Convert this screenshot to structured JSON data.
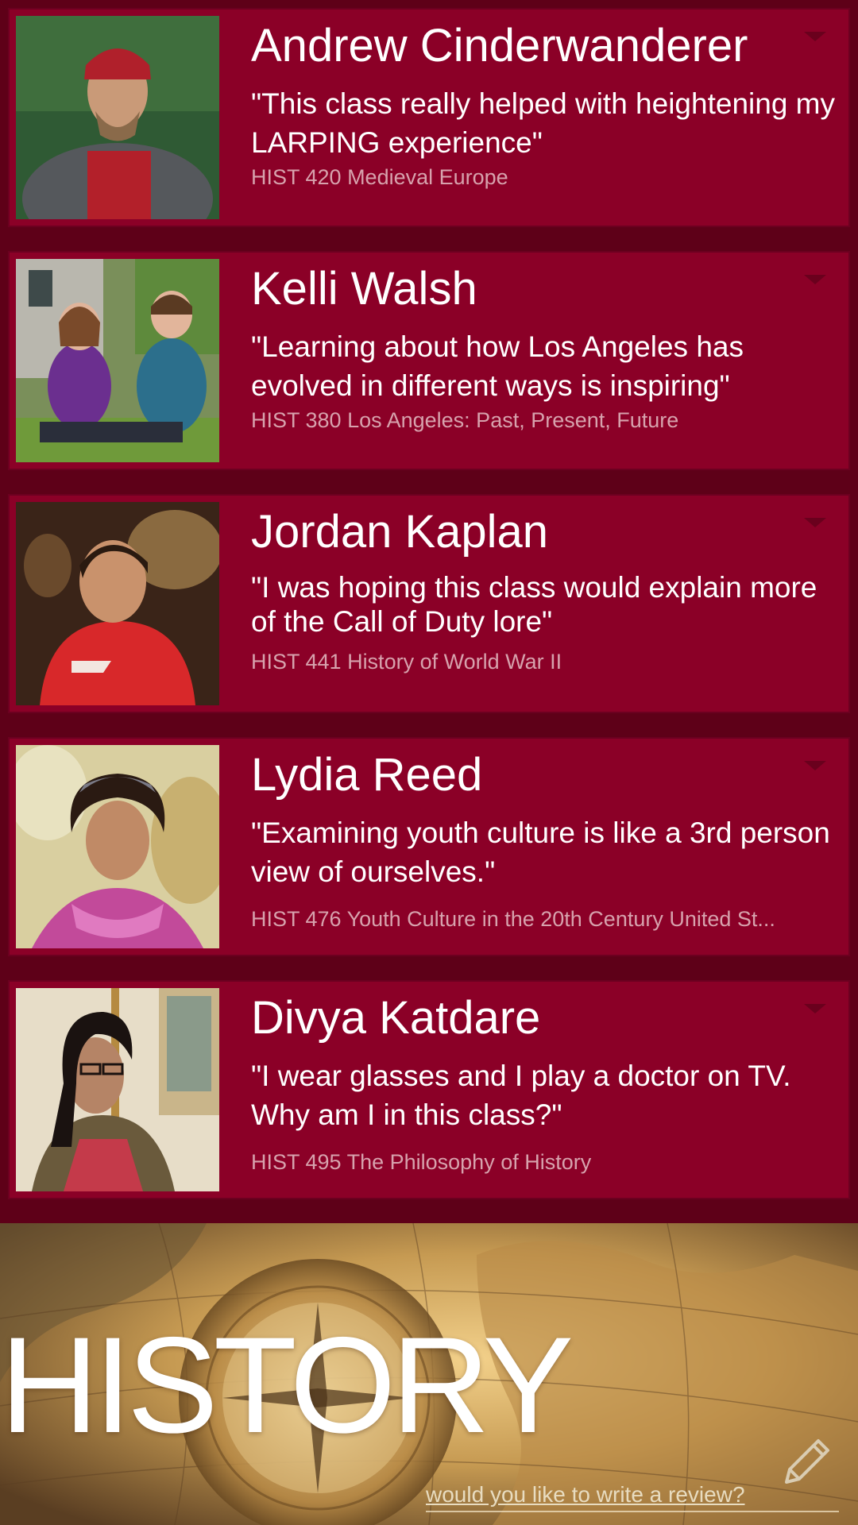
{
  "reviews": [
    {
      "name": "Andrew Cinderwanderer",
      "quote": "\"This class really helped with heightening my LARPING experience\"",
      "course": "HIST 420 Medieval Europe"
    },
    {
      "name": "Kelli Walsh",
      "quote": "\"Learning about how Los Angeles has evolved in different ways is inspiring\"",
      "course": "HIST 380 Los Angeles: Past, Present, Future"
    },
    {
      "name": "Jordan Kaplan",
      "quote": "\"I was hoping this class would explain more of the Call of Duty lore\"",
      "course": "HIST 441 History of World War II"
    },
    {
      "name": "Lydia Reed",
      "quote": "\"Examining youth culture is like a 3rd person view of ourselves.\"",
      "course": "HIST 476 Youth Culture in the 20th Century United St..."
    },
    {
      "name": "Divya Katdare",
      "quote": "\"I wear glasses and I play a doctor on TV. Why am I in this class?\"",
      "course": "HIST 495 The Philosophy of History"
    }
  ],
  "footer": {
    "title": "HISTORY",
    "review_link": "would you like to write a review?",
    "pencil_icon": "pencil-icon"
  },
  "colors": {
    "card": "#8b0027",
    "background": "#5e0018",
    "course_text": "#d7a2ad"
  }
}
